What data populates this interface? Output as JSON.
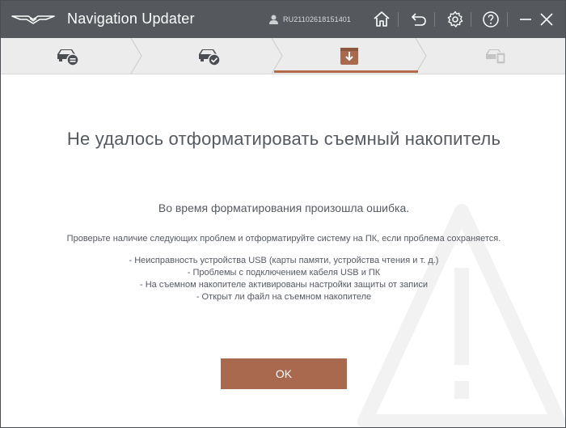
{
  "window": {
    "app_title": "Navigation Updater",
    "user_id": "RU21102618151401"
  },
  "toolbar": {
    "icons": [
      "home-icon",
      "back-icon",
      "gear-icon",
      "help-icon",
      "minimize-icon",
      "close-icon"
    ]
  },
  "steps": [
    {
      "icon": "car-usb-icon",
      "state": "done"
    },
    {
      "icon": "car-check-icon",
      "state": "done"
    },
    {
      "icon": "download-icon",
      "state": "active"
    },
    {
      "icon": "car-device-icon",
      "state": "pending"
    }
  ],
  "colors": {
    "titlebar": "#55585d",
    "accent": "#a8694e",
    "text": "#555a62",
    "stepbar": "#ececec"
  },
  "dialog": {
    "title": "Не удалось отформатировать съемный накопитель",
    "message": "Во время форматирования произошла ошибка.",
    "instruction": "Проверьте наличие следующих проблем и отформатируйте систему на ПК, если проблема сохраняется.",
    "issues": [
      "- Неисправность устройства USB (карты памяти, устройства чтения и т. д.)",
      "- Проблемы с подключением кабеля USB и ПК",
      "- На съемном накопителе активированы настройки защиты от записи",
      "- Открыт ли файл на съемном накопителе"
    ],
    "ok_label": "OK"
  }
}
